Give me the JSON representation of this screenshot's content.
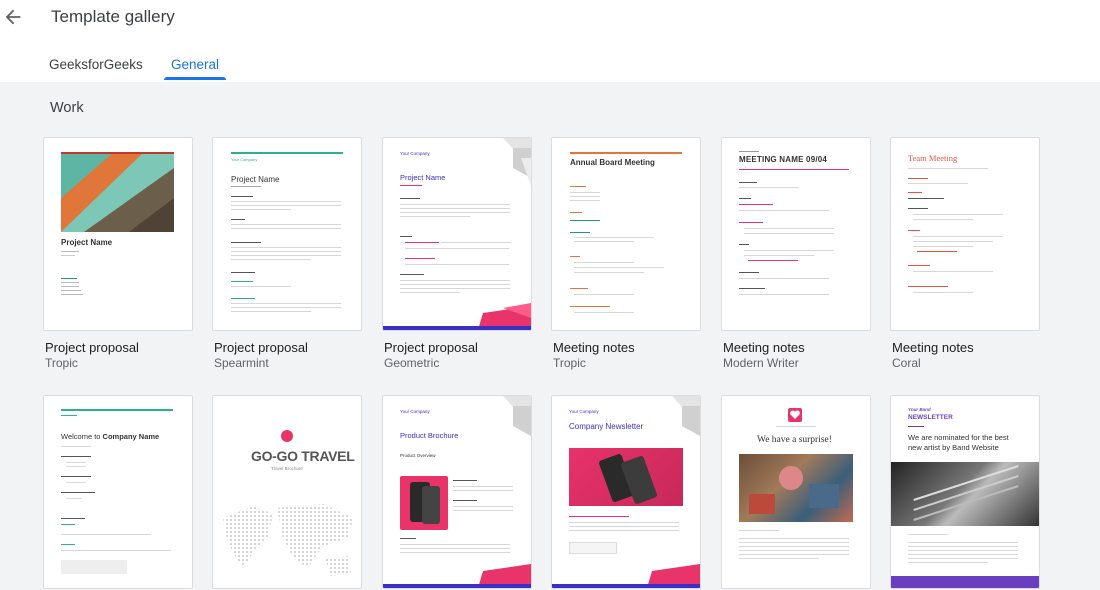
{
  "header": {
    "title": "Template gallery"
  },
  "tabs": [
    {
      "label": "GeeksforGeeks"
    },
    {
      "label": "General"
    }
  ],
  "section": {
    "label": "Work"
  },
  "cards": [
    {
      "title": "Project proposal",
      "subtitle": "Tropic",
      "preview_heading": "Project Name"
    },
    {
      "title": "Project proposal",
      "subtitle": "Spearmint",
      "preview_company": "Your Company",
      "preview_heading": "Project Name"
    },
    {
      "title": "Project proposal",
      "subtitle": "Geometric",
      "preview_company": "Your Company",
      "preview_heading": "Project Name"
    },
    {
      "title": "Meeting notes",
      "subtitle": "Tropic",
      "preview_heading": "Annual Board Meeting"
    },
    {
      "title": "Meeting notes",
      "subtitle": "Modern Writer",
      "preview_heading": "MEETING NAME 09/04"
    },
    {
      "title": "Meeting notes",
      "subtitle": "Coral",
      "preview_heading": "Team Meeting"
    },
    {
      "preview_heading_plain": "Welcome to ",
      "preview_heading_bold": "Company Name"
    },
    {
      "preview_heading": "GO-GO TRAVEL",
      "preview_sub": "Travel Brochure"
    },
    {
      "preview_company": "Your Company",
      "preview_heading": "Product Brochure",
      "preview_sub": "Product Overview"
    },
    {
      "preview_company": "Your Company",
      "preview_heading": "Company Newsletter"
    },
    {
      "preview_heading": "We have a surprise!"
    },
    {
      "preview_small": "Your Band",
      "preview_label": "NEWSLETTER",
      "preview_heading": "We are nominated for the best new artist by Band Website"
    }
  ],
  "colors": {
    "accent": "#1a73e8",
    "coral": "#e8533f",
    "purple": "#3b2fc9",
    "pink": "#e8336b",
    "teal": "#00a37a"
  }
}
